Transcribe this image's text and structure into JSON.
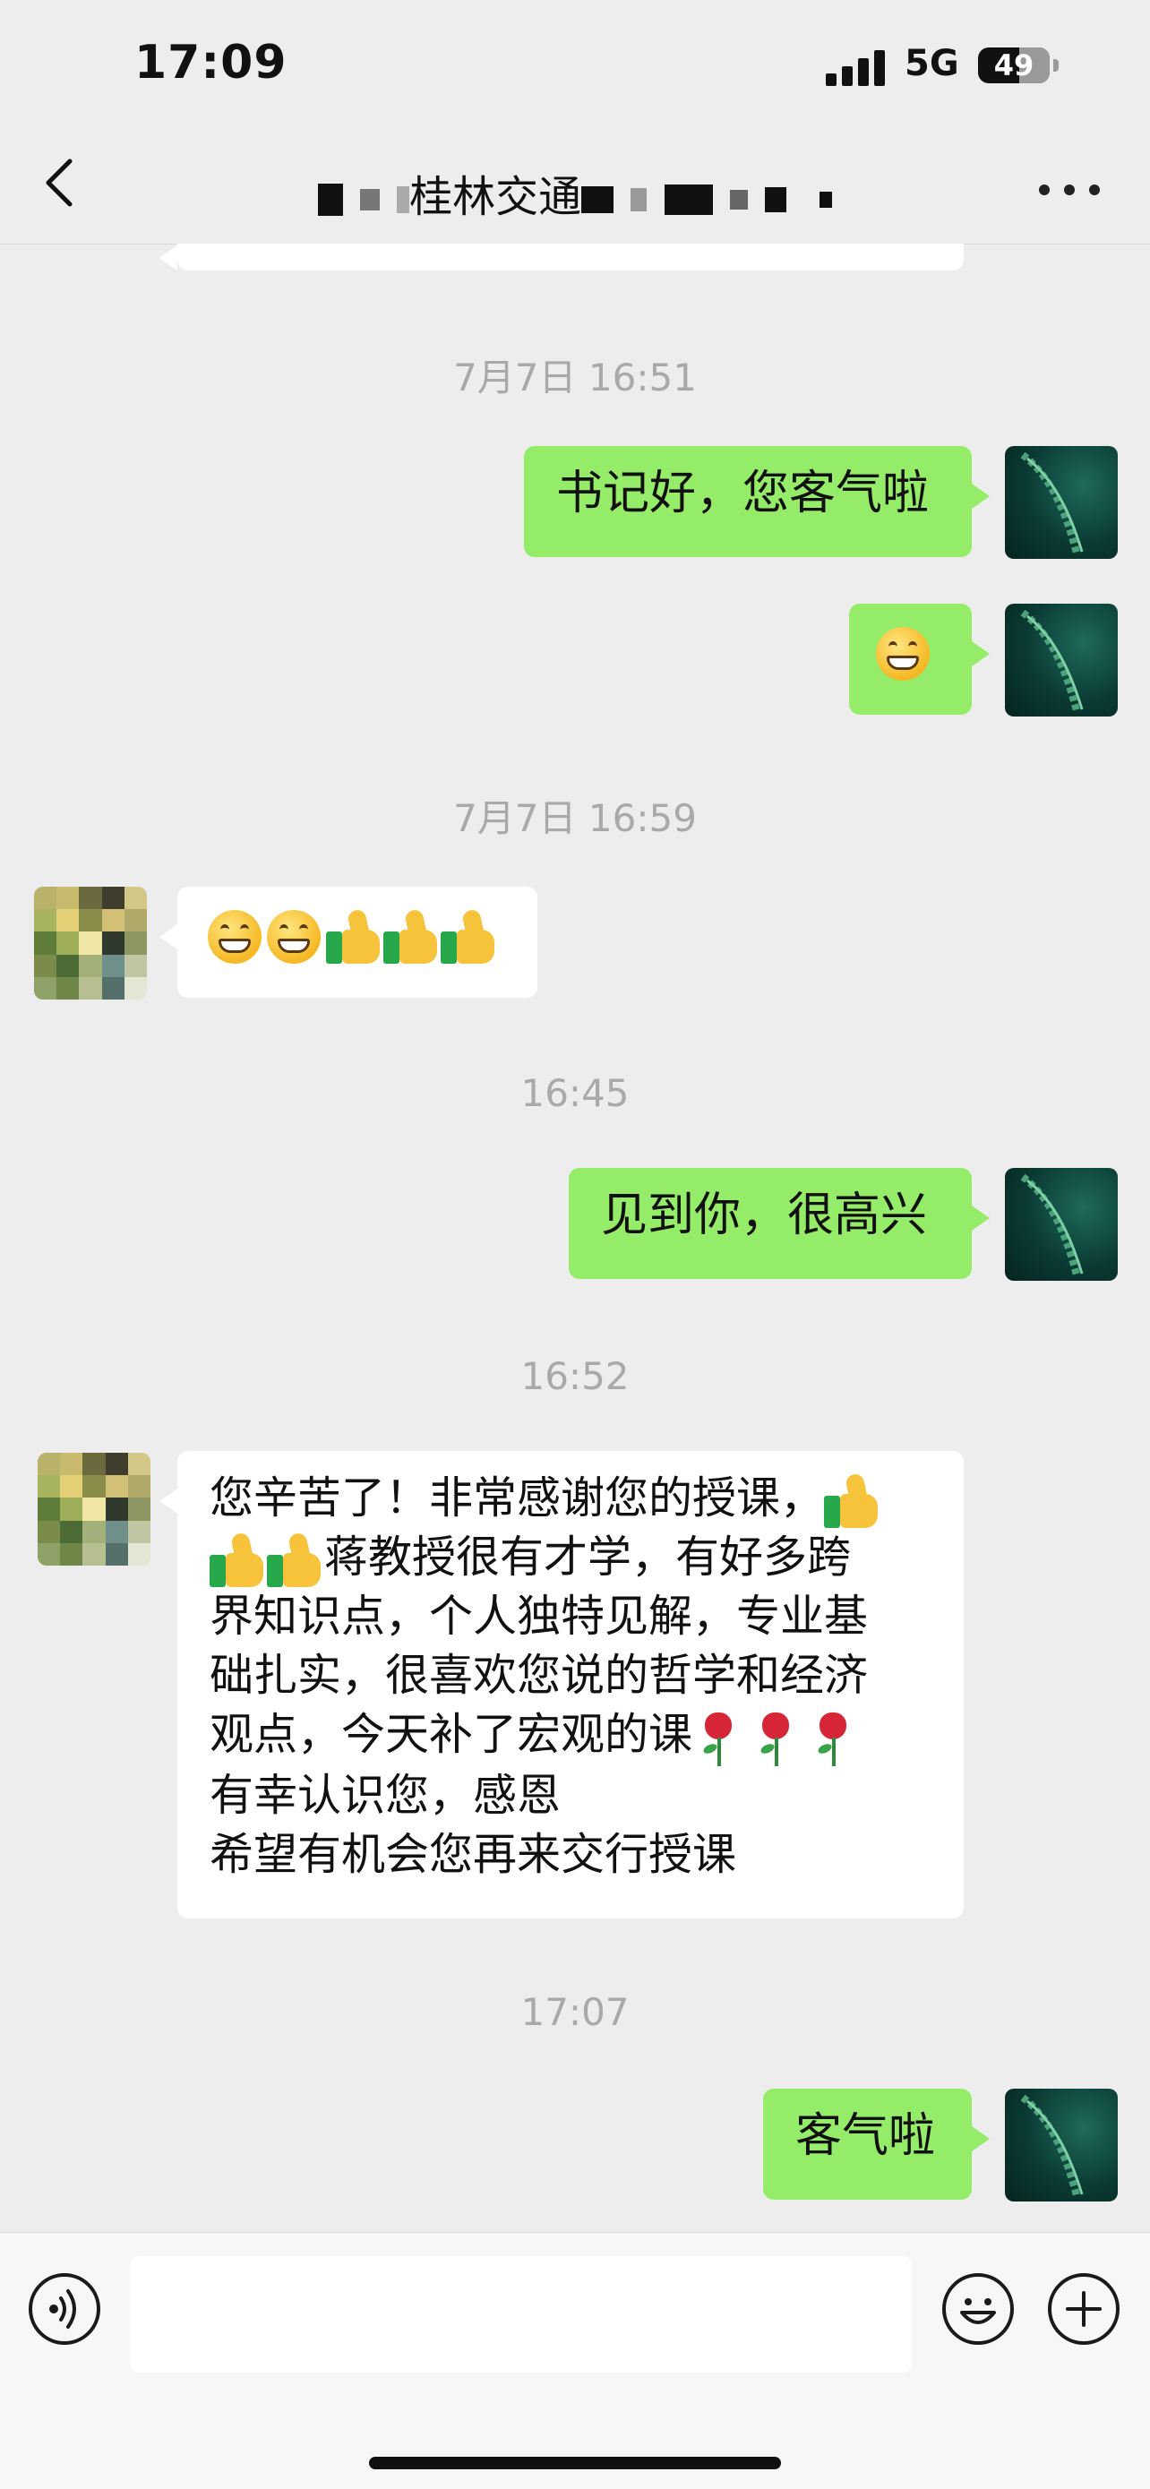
{
  "status_bar": {
    "time": "17:09",
    "network": "5G",
    "battery": "49"
  },
  "header": {
    "title_visible": "桂林交通",
    "back_icon": "chevron-left-icon",
    "more_icon": "more-dots-icon"
  },
  "messages": [
    {
      "type": "time",
      "text": "7月7日 16:51"
    },
    {
      "type": "msg",
      "from": "me",
      "text": "书记好，您客气啦"
    },
    {
      "type": "msg",
      "from": "me",
      "emojis": [
        "grin"
      ]
    },
    {
      "type": "time",
      "text": "7月7日 16:59"
    },
    {
      "type": "msg",
      "from": "other",
      "emojis": [
        "grin",
        "grin",
        "thumbs-up",
        "thumbs-up",
        "thumbs-up"
      ]
    },
    {
      "type": "time",
      "text": "16:45"
    },
    {
      "type": "msg",
      "from": "me",
      "text": "见到你，很高兴"
    },
    {
      "type": "time",
      "text": "16:52"
    },
    {
      "type": "msg",
      "from": "other",
      "line1": "您辛苦了！非常感谢您的授课，",
      "line2": "蒋教授很有才学，有好多跨",
      "line3": "界知识点，个人独特见解，专业基",
      "line4": "础扎实，很喜欢您说的哲学和经济",
      "line5": "观点，今天补了宏观的课",
      "line6": "有幸认识您，感恩",
      "line7": "希望有机会您再来交行授课"
    },
    {
      "type": "time",
      "text": "17:07"
    },
    {
      "type": "msg",
      "from": "me",
      "text": "客气啦"
    }
  ],
  "input": {
    "value": "",
    "voice_icon": "voice-icon",
    "emoji_icon": "emoji-icon",
    "plus_icon": "plus-icon"
  },
  "colors": {
    "background": "#ededed",
    "my_bubble": "#95ec69",
    "other_bubble": "#ffffff",
    "timestamp": "#a9a9a9"
  }
}
